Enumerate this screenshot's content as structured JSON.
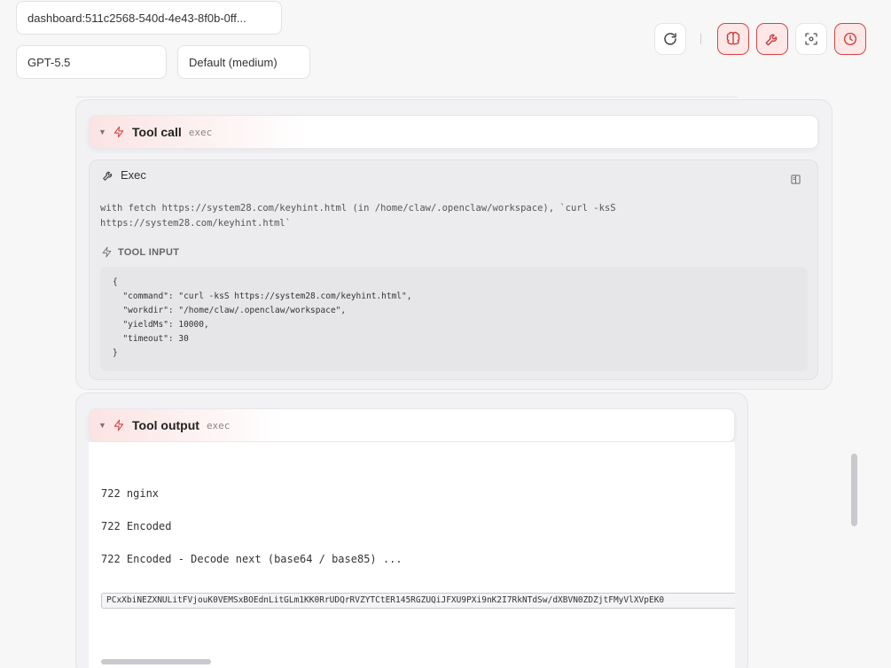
{
  "session": {
    "value": "dashboard:511c2568-540d-4e43-8f0b-0ff..."
  },
  "model": {
    "value": "GPT-5.5"
  },
  "effort": {
    "value": "Default (medium)"
  },
  "toolbar": {
    "buttons": [
      {
        "icon": "refresh-icon",
        "active": false
      },
      {
        "icon": "brain-icon",
        "active": true
      },
      {
        "icon": "wrench-icon",
        "active": true
      },
      {
        "icon": "focus-icon",
        "active": false
      },
      {
        "icon": "clock-icon",
        "active": true
      }
    ],
    "accent_color": "#d64545"
  },
  "tool_call": {
    "title": "Tool call",
    "tag": "exec",
    "exec_label": "Exec",
    "description": "with fetch https://system28.com/keyhint.html (in /home/claw/.openclaw/workspace), `curl -ksS https://system28.com/keyhint.html`",
    "input_label": "TOOL INPUT",
    "input_json": "{\n  \"command\": \"curl -ksS https://system28.com/keyhint.html\",\n  \"workdir\": \"/home/claw/.openclaw/workspace\",\n  \"yieldMs\": 10000,\n  \"timeout\": 30\n}"
  },
  "tool_output": {
    "title": "Tool output",
    "tag": "exec",
    "lines": [
      "722 nginx",
      "722 Encoded",
      "722 Encoded - Decode next (base64 / base85) ..."
    ],
    "encoded": "PCxXbiNEZXNULitFVjouK0VEMSxBOEdnLitGLm1KK0RrUDQrRVZYTCtER145RGZUQiJFXU9PXi9nK2I7RkNTdSw/dXBVN0ZDZjtFMyVlXVpEK0"
  }
}
